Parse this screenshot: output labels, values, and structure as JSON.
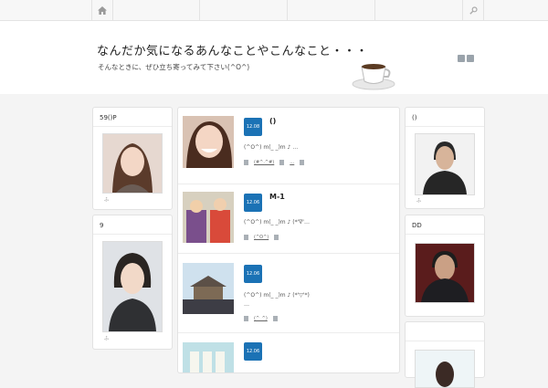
{
  "nav": {
    "home_icon": "home-icon",
    "search_icon": "search-icon"
  },
  "header": {
    "title": "なんだか気になるあんなことやこんなこと・・・",
    "description": "そんなときに、ぜひ立ち寄ってみて下さい(^O^)",
    "social": [
      "rss-icon",
      "twitter-icon"
    ]
  },
  "left_widgets": [
    {
      "title": "59()P",
      "caption": "ふ"
    },
    {
      "title": "9",
      "caption": "ふ"
    }
  ],
  "right_widgets": [
    {
      "title": "()",
      "caption": "ふ"
    },
    {
      "title": "DD",
      "caption": "ふ"
    },
    {
      "title": ""
    }
  ],
  "posts": [
    {
      "date": "12.08",
      "title": "()",
      "excerpt": "(^O^) m(_ _)m ♪ …",
      "category": "(#^.^#)",
      "tag": "…"
    },
    {
      "date": "12.06",
      "title": "M-1",
      "excerpt": "(^O^) m(_ _)m ♪ (*'∇'…",
      "category": "(^O^)"
    },
    {
      "date": "12.06",
      "title": "",
      "excerpt": "(^O^) m(_ _)m ♪ (*'▽'*)",
      "excerpt2": "…",
      "category": "(^_^)"
    },
    {
      "date": "12.06",
      "title": ""
    }
  ],
  "colors": {
    "date_badge": "#1b72b5",
    "background": "#f4f4f4"
  }
}
